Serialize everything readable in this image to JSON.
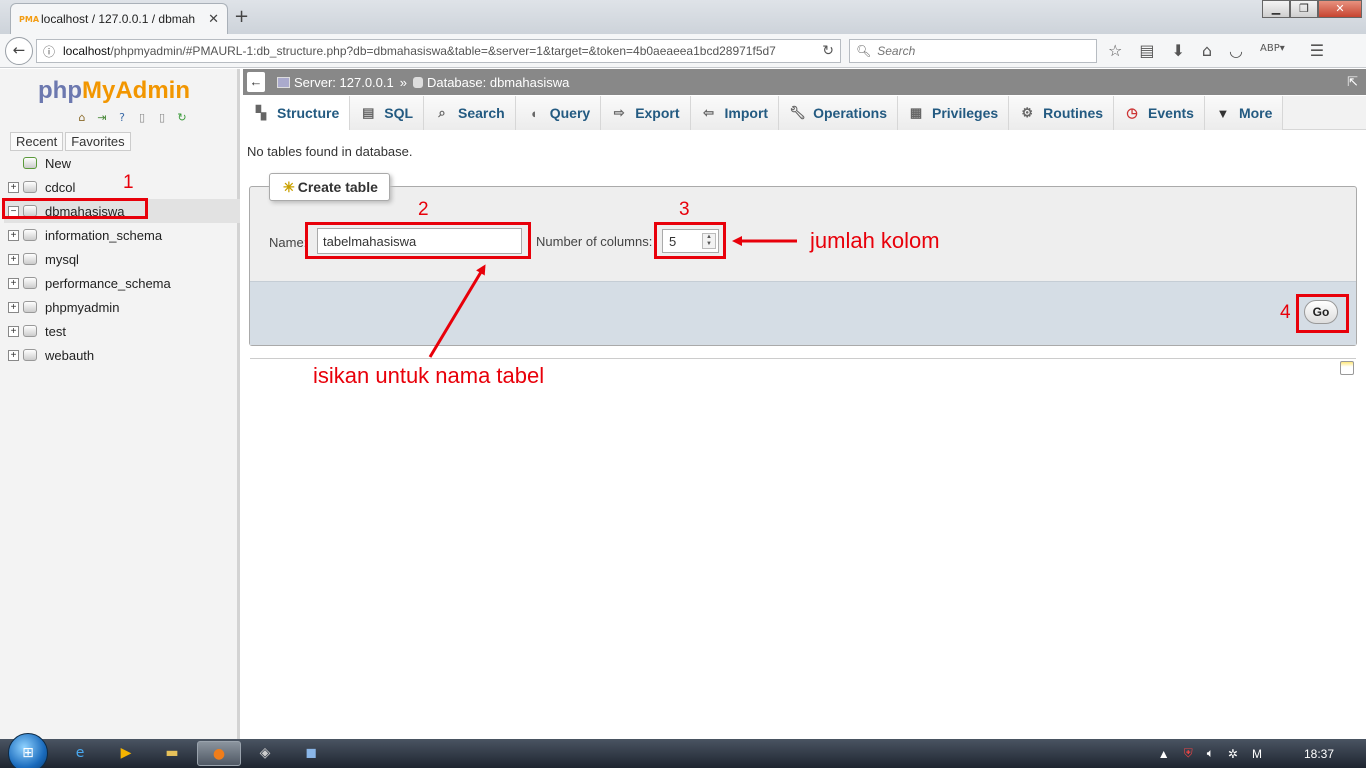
{
  "browser": {
    "tab_title": "localhost / 127.0.0.1 / dbmah",
    "tab_favicon": "PMA",
    "url_host": "localhost",
    "url_path": "/phpmyadmin/#PMAURL-1:db_structure.php?db=dbmahasiswa&table=&server=1&target=&token=4b0aeaeea1bcd28971f5d7",
    "search_placeholder": "Search"
  },
  "logo": {
    "php": "php",
    "my": "My",
    "admin": "Admin"
  },
  "nav": {
    "recent": "Recent",
    "favorites": "Favorites",
    "databases": [
      {
        "name": "New"
      },
      {
        "name": "cdcol"
      },
      {
        "name": "dbmahasiswa"
      },
      {
        "name": "information_schema"
      },
      {
        "name": "mysql"
      },
      {
        "name": "performance_schema"
      },
      {
        "name": "phpmyadmin"
      },
      {
        "name": "test"
      },
      {
        "name": "webauth"
      }
    ]
  },
  "breadcrumb": {
    "server": "Server: 127.0.0.1",
    "separator": "»",
    "database": "Database: dbmahasiswa"
  },
  "menu": [
    {
      "label": "Structure",
      "icon": "structure-icon"
    },
    {
      "label": "SQL",
      "icon": "sql-icon"
    },
    {
      "label": "Search",
      "icon": "search-icon"
    },
    {
      "label": "Query",
      "icon": "query-icon"
    },
    {
      "label": "Export",
      "icon": "export-icon"
    },
    {
      "label": "Import",
      "icon": "import-icon"
    },
    {
      "label": "Operations",
      "icon": "wrench-icon"
    },
    {
      "label": "Privileges",
      "icon": "privileges-icon"
    },
    {
      "label": "Routines",
      "icon": "routines-icon"
    },
    {
      "label": "Events",
      "icon": "clock-icon"
    },
    {
      "label": "More",
      "icon": "caret-down-icon"
    }
  ],
  "main": {
    "notice": "No tables found in database.",
    "create_table_legend": "Create table",
    "name_label": "Name:",
    "name_value": "tabelmahasiswa",
    "columns_label": "Number of columns:",
    "columns_value": "5",
    "go_label": "Go"
  },
  "annotations": {
    "n1": "1",
    "n2": "2",
    "n3": "3",
    "n4": "4",
    "jumlah_kolom": "jumlah kolom",
    "isikan": "isikan untuk nama tabel",
    "color": "#e8000a"
  },
  "taskbar": {
    "clock": "18:37",
    "tray_m": "M"
  }
}
